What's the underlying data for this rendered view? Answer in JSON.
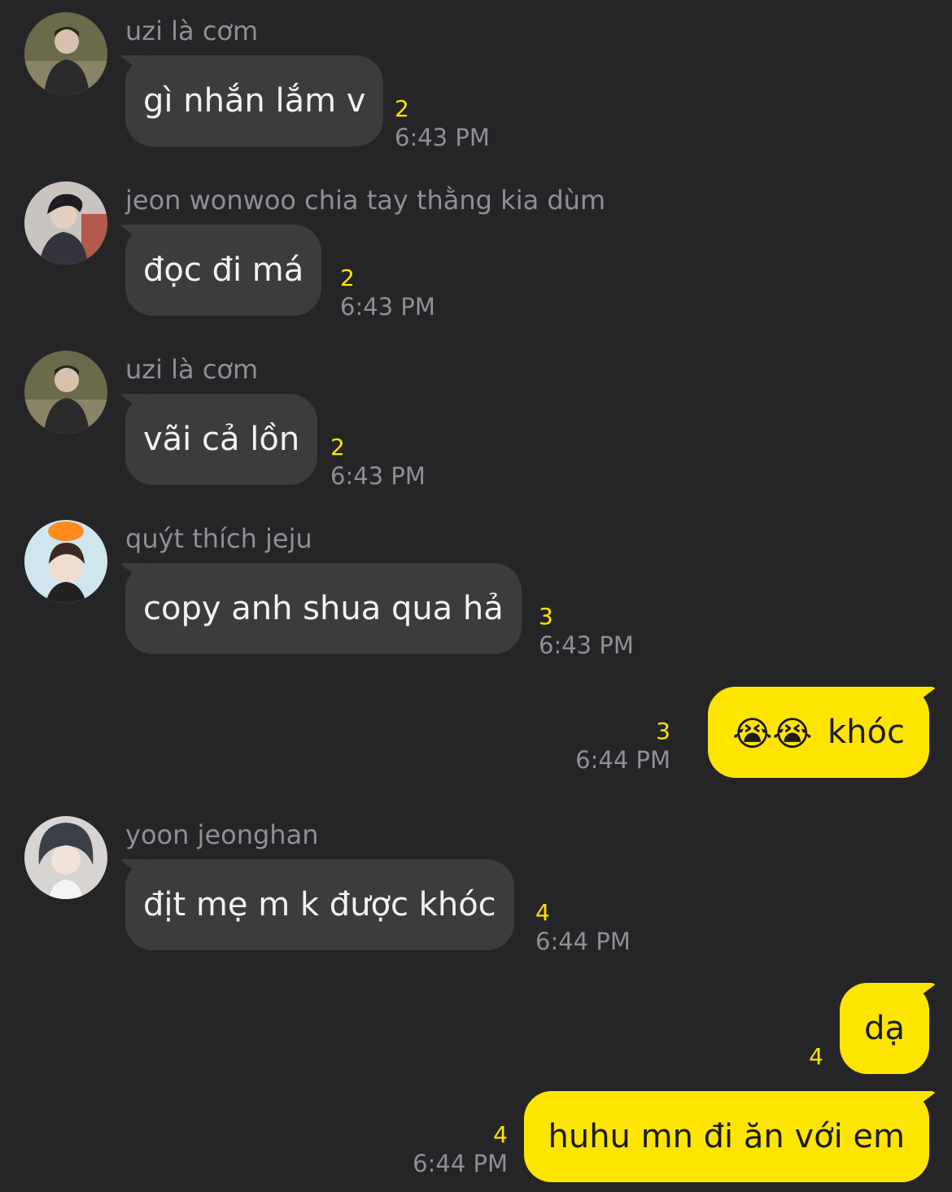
{
  "colors": {
    "background": "#252528",
    "incoming_bubble": "#3c3c3f",
    "outgoing_bubble": "#fee500",
    "unread_count": "#fee500",
    "meta_text": "#8f8f94"
  },
  "messages": [
    {
      "direction": "in",
      "sender": "uzi là cơm",
      "avatar": "avatar-photo-icon",
      "text": "gì nhắn lắm v",
      "unread": "2",
      "time": "6:43 PM"
    },
    {
      "direction": "in",
      "sender": "jeon wonwoo chia tay thằng kia dùm",
      "avatar": "avatar-photo-icon",
      "text": "đọc đi má",
      "unread": "2",
      "time": "6:43 PM"
    },
    {
      "direction": "in",
      "sender": "uzi là cơm",
      "avatar": "avatar-photo-icon",
      "text": "vãi cả lồn",
      "unread": "2",
      "time": "6:43 PM"
    },
    {
      "direction": "in",
      "sender": "quýt thích jeju",
      "avatar": "avatar-photo-icon",
      "text": "copy anh shua qua hả",
      "unread": "3",
      "time": "6:43 PM"
    },
    {
      "direction": "out",
      "emoji": "😭😭",
      "text": "khóc",
      "unread": "3",
      "time": "6:44 PM"
    },
    {
      "direction": "in",
      "sender": "yoon jeonghan",
      "avatar": "avatar-photo-icon",
      "text": "địt mẹ m k được khóc",
      "unread": "4",
      "time": "6:44 PM"
    },
    {
      "direction": "out",
      "text": "dạ",
      "unread": "4"
    },
    {
      "direction": "out",
      "text": "huhu mn đi ăn với em",
      "unread": "4",
      "time": "6:44 PM"
    }
  ]
}
